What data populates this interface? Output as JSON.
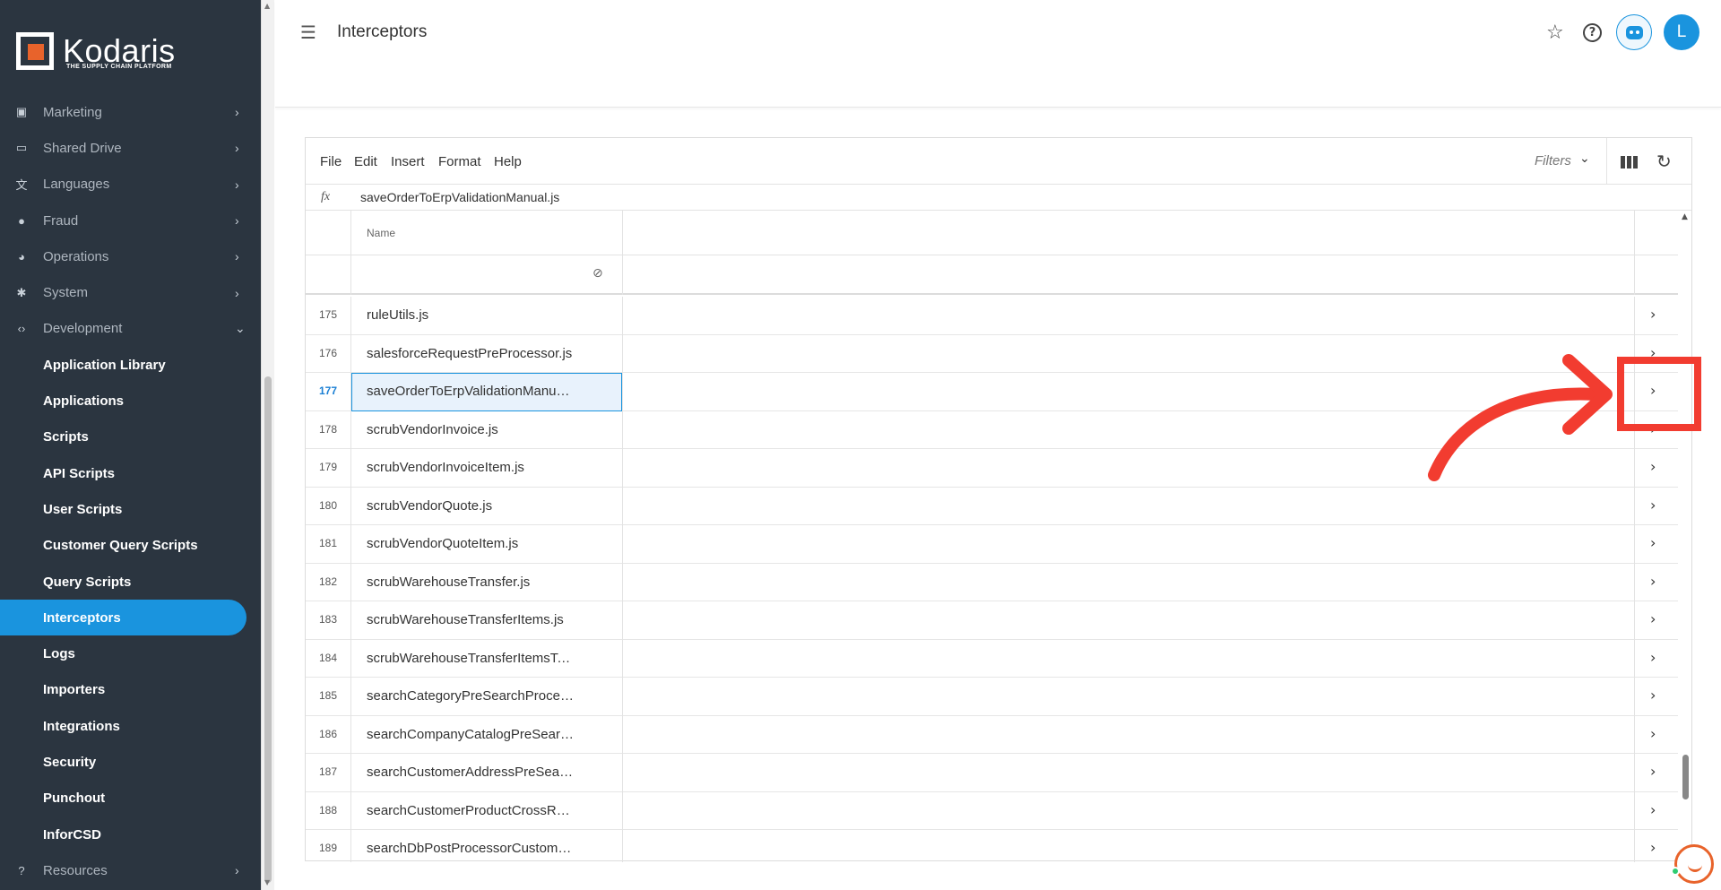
{
  "brand": {
    "name": "Kodaris",
    "tagline": "THE SUPPLY CHAIN PLATFORM",
    "accent": "#e8632b",
    "primary": "#1a94de",
    "sidebar_bg": "#2b3540"
  },
  "sidebar": {
    "top_items": [
      {
        "label": "Marketing",
        "icon": "megaphone-icon"
      },
      {
        "label": "Shared Drive",
        "icon": "folder-icon"
      },
      {
        "label": "Languages",
        "icon": "translate-icon"
      },
      {
        "label": "Fraud",
        "icon": "alert-icon"
      },
      {
        "label": "Operations",
        "icon": "chart-pie-icon"
      },
      {
        "label": "System",
        "icon": "gear-icon"
      },
      {
        "label": "Development",
        "icon": "code-icon"
      }
    ],
    "dev_items": [
      {
        "label": "Application Library"
      },
      {
        "label": "Applications"
      },
      {
        "label": "Scripts"
      },
      {
        "label": "API Scripts"
      },
      {
        "label": "User Scripts"
      },
      {
        "label": "Customer Query Scripts"
      },
      {
        "label": "Query Scripts"
      },
      {
        "label": "Interceptors",
        "active": true
      },
      {
        "label": "Logs"
      },
      {
        "label": "Importers"
      },
      {
        "label": "Integrations"
      },
      {
        "label": "Security"
      },
      {
        "label": "Punchout"
      },
      {
        "label": "InforCSD"
      }
    ],
    "bottom_item": {
      "label": "Resources",
      "icon": "help-circle-icon"
    }
  },
  "header": {
    "title": "Interceptors",
    "avatar_initial": "L"
  },
  "toolbar": {
    "menus": [
      "File",
      "Edit",
      "Insert",
      "Format",
      "Help"
    ],
    "filters_label": "Filters"
  },
  "formula_bar": {
    "label": "fx",
    "value": "saveOrderToErpValidationManual.js"
  },
  "grid": {
    "columns": [
      "Name"
    ],
    "selected_row": 177,
    "rows": [
      {
        "num": "175",
        "name": "ruleUtils.js"
      },
      {
        "num": "176",
        "name": "salesforceRequestPreProcessor.js"
      },
      {
        "num": "177",
        "name": "saveOrderToErpValidationManual.js"
      },
      {
        "num": "178",
        "name": "scrubVendorInvoice.js"
      },
      {
        "num": "179",
        "name": "scrubVendorInvoiceItem.js"
      },
      {
        "num": "180",
        "name": "scrubVendorQuote.js"
      },
      {
        "num": "181",
        "name": "scrubVendorQuoteItem.js"
      },
      {
        "num": "182",
        "name": "scrubWarehouseTransfer.js"
      },
      {
        "num": "183",
        "name": "scrubWarehouseTransferItems.js"
      },
      {
        "num": "184",
        "name": "scrubWarehouseTransferItemsToDelete.js"
      },
      {
        "num": "185",
        "name": "searchCategoryPreSearchProcessor.js"
      },
      {
        "num": "186",
        "name": "searchCompanyCatalogPreSearchProce..."
      },
      {
        "num": "187",
        "name": "searchCustomerAddressPreSearchProc..."
      },
      {
        "num": "188",
        "name": "searchCustomerProductCrossReference..."
      },
      {
        "num": "189",
        "name": "searchDbPostProcessorCustomFields.js"
      }
    ]
  },
  "annotation": {
    "color": "#f23c30"
  }
}
